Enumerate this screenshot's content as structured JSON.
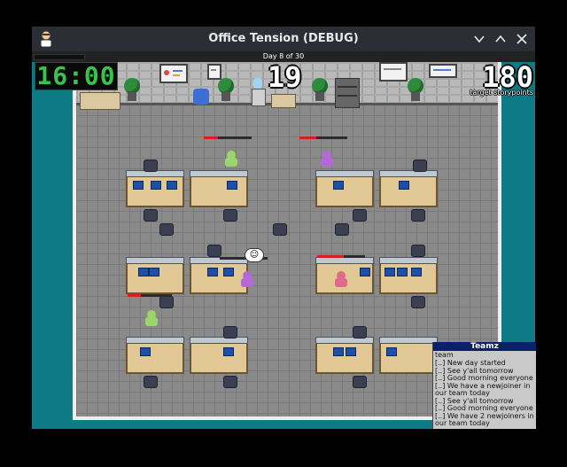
{
  "window": {
    "title": "Office Tension (DEBUG)"
  },
  "hud": {
    "day_label": "Day 8 of 30",
    "clock": "16:00",
    "current_storypoints": "19",
    "target_storypoints": "180",
    "target_label": "target storypoints"
  },
  "chat": {
    "title": "Teamz",
    "channel": "team",
    "messages": [
      "[..] New day started",
      "[..] See y'all tomorrow",
      "[..] Good morning everyone",
      "[..] We have a newjoiner in our team today",
      "[..] See y'all tomorrow",
      "[..] Good morning everyone",
      "[..] We have 2 newjoiners in our team today"
    ]
  },
  "workers": [
    {
      "id": "w1",
      "color": "#9ad66a",
      "tension": 0.3
    },
    {
      "id": "w2",
      "color": "#b46ad6",
      "tension": 0.35
    },
    {
      "id": "w3",
      "color": "#b46ad6",
      "tension": 0.0
    },
    {
      "id": "w4",
      "color": "#e06a8a",
      "tension": 0.55
    },
    {
      "id": "w5",
      "color": "#9ad66a",
      "tension": 0.3
    }
  ],
  "colors": {
    "background_teal": "#0d7a86",
    "clock_green": "#38c44a",
    "chat_header": "#0b1f6b",
    "tension_red": "#d42020"
  },
  "icons": [
    "app-icon",
    "chevron-down-icon",
    "chevron-up-icon",
    "close-icon",
    "smiley-icon"
  ]
}
